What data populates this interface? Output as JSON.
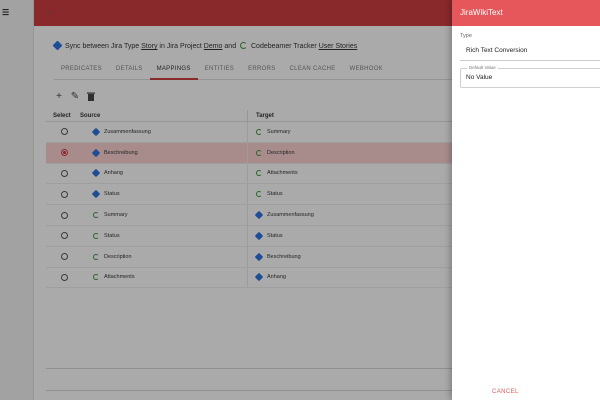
{
  "app": {
    "logo_text": "☰",
    "collapse_glyph": "‹"
  },
  "title": {
    "prefix": "Sync between Jira Type",
    "jira_type": "Story",
    "mid1": "in Jira Project",
    "jira_project": "Demo",
    "mid2": "and",
    "mid3": "Codebeamer Tracker",
    "cb_tracker": "User Stories"
  },
  "tabs": [
    {
      "label": "PREDICATES"
    },
    {
      "label": "DETAILS"
    },
    {
      "label": "MAPPINGS",
      "active": true
    },
    {
      "label": "ENTITIES"
    },
    {
      "label": "ERRORS"
    },
    {
      "label": "CLEAN CACHE"
    },
    {
      "label": "WEBHOOK"
    }
  ],
  "toolbar": {
    "add_glyph": "+",
    "edit_glyph": "✎",
    "delete_glyph": "■"
  },
  "table": {
    "headers": {
      "select": "Select",
      "source": "Source",
      "target": "Target"
    },
    "rows": [
      {
        "source": "Zusammenfassung",
        "source_icon": "jira-icon",
        "target": "Summary",
        "target_icon": "codebeamer-icon",
        "selected": false
      },
      {
        "source": "Beschreibung",
        "source_icon": "jira-icon",
        "target": "Description",
        "target_icon": "codebeamer-icon",
        "selected": true
      },
      {
        "source": "Anhang",
        "source_icon": "jira-icon",
        "target": "Attachments",
        "target_icon": "codebeamer-icon",
        "selected": false
      },
      {
        "source": "Status",
        "source_icon": "jira-icon",
        "target": "Status",
        "target_icon": "codebeamer-icon",
        "selected": false
      },
      {
        "source": "Summary",
        "source_icon": "codebeamer-icon",
        "target": "Zusammenfassung",
        "target_icon": "jira-icon",
        "selected": false
      },
      {
        "source": "Status",
        "source_icon": "codebeamer-icon",
        "target": "Status",
        "target_icon": "jira-icon",
        "selected": false
      },
      {
        "source": "Description",
        "source_icon": "codebeamer-icon",
        "target": "Beschreibung",
        "target_icon": "jira-icon",
        "selected": false
      },
      {
        "source": "Attachments",
        "source_icon": "codebeamer-icon",
        "target": "Anhang",
        "target_icon": "jira-icon",
        "selected": false
      }
    ]
  },
  "drawer": {
    "title": "JiraWikiText",
    "type_label": "Type",
    "type_value": "Rich Text Conversion",
    "default_label": "Default Value",
    "default_value": "No Value",
    "cancel_label": "CANCEL"
  },
  "colors": {
    "brand_red": "#c53b3f",
    "drawer_header": "#e5575b",
    "jira_blue": "#2c6fd6",
    "codebeamer_green": "#3f8f3f"
  }
}
